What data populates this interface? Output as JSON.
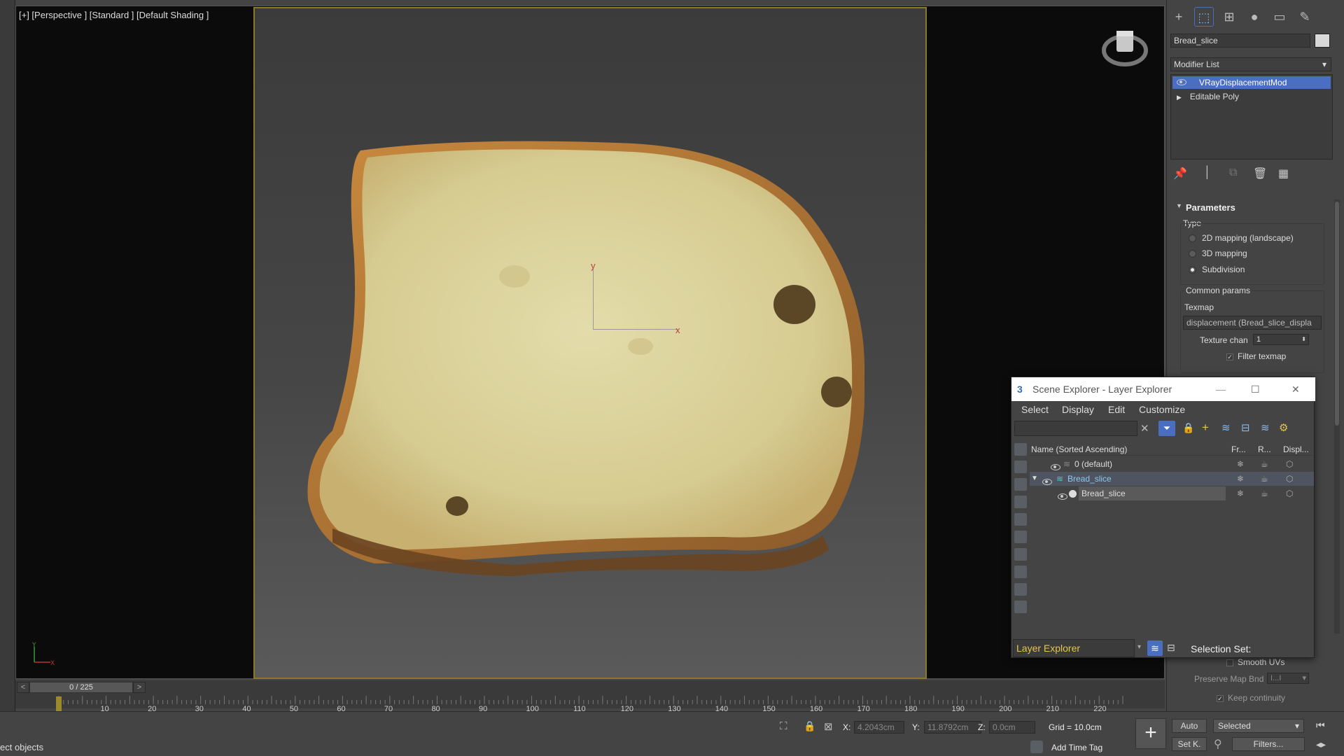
{
  "viewport": {
    "label": "[+] [Perspective ] [Standard ] [Default Shading ]",
    "axis_x": "x",
    "axis_y": "y"
  },
  "timeline": {
    "frame": "0 / 225",
    "prev": "<",
    "next": ">",
    "ticks": [
      "10",
      "20",
      "30",
      "40",
      "50",
      "60",
      "70",
      "80",
      "90",
      "100",
      "110",
      "120",
      "130",
      "140",
      "150",
      "160",
      "170",
      "180",
      "190",
      "200",
      "210",
      "220"
    ]
  },
  "status": {
    "prompt": "ect objects",
    "x_label": "X:",
    "x_value": "4.2043cm",
    "y_label": "Y:",
    "y_value": "11.8792cm",
    "z_label": "Z:",
    "z_value": "0.0cm",
    "grid": "Grid = 10.0cm",
    "add_time_tag": "Add Time Tag",
    "auto": "Auto",
    "selected": "Selected",
    "set_key": "Set K.",
    "filters": "Filters..."
  },
  "command_panel": {
    "object_name": "Bread_slice",
    "modifier_list": "Modifier List",
    "stack": [
      "VRayDisplacementMod",
      "Editable Poly"
    ],
    "parameters": {
      "title": "Parameters",
      "type_label": "Type",
      "type_options": [
        "2D mapping (landscape)",
        "3D mapping",
        "Subdivision"
      ],
      "selected_type": "Subdivision",
      "common_params": "Common params",
      "texmap_label": "Texmap",
      "texmap_value": "displacement (Bread_slice_displa",
      "texture_chan_label": "Texture chan",
      "texture_chan_value": "1",
      "filter_texmap": "Filter texmap",
      "smooth_uvs": "Smooth UVs",
      "preserve_map_bnd": "Preserve Map Bnd",
      "preserve_map_value": "I...I",
      "keep_continuity": "Keep continuity"
    }
  },
  "scene_explorer": {
    "title": "Scene Explorer - Layer Explorer",
    "menu": [
      "Select",
      "Display",
      "Edit",
      "Customize"
    ],
    "columns": {
      "name": "Name (Sorted Ascending)",
      "freeze": "Fr...",
      "render": "R...",
      "display": "Displ..."
    },
    "rows": [
      {
        "name": "0 (default)",
        "level": 0
      },
      {
        "name": "Bread_slice",
        "level": 0
      },
      {
        "name": "Bread_slice",
        "level": 1
      }
    ],
    "layer_dropdown": "Layer Explorer",
    "selection_set": "Selection Set:"
  },
  "colors": {
    "accent_blue": "#4a6ec2",
    "safe_frame": "#8b7a25",
    "layer_text": "#e4c64a"
  }
}
